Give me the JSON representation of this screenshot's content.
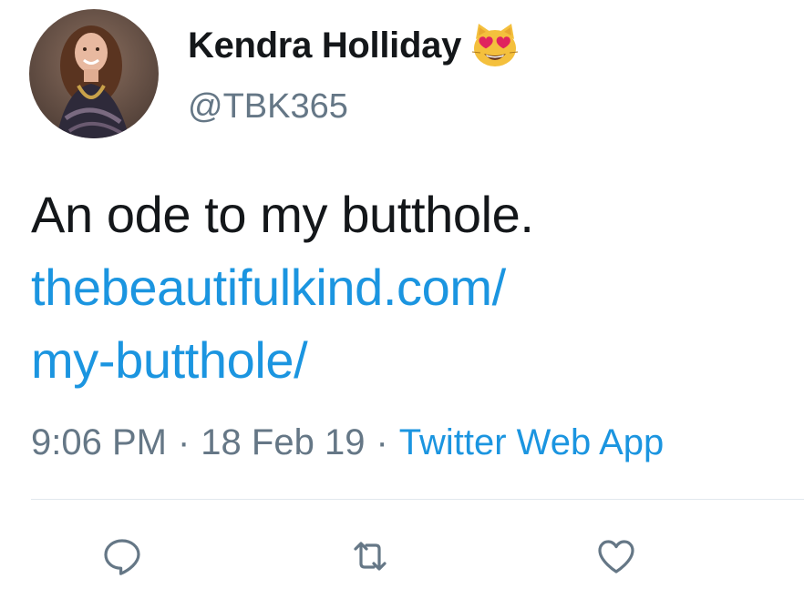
{
  "user": {
    "display_name": "Kendra Holliday",
    "name_emoji": "smiling-cat-heart-eyes-emoji",
    "handle": "@TBK365",
    "avatar": "profile-photo"
  },
  "tweet": {
    "text": "An ode to my butthole.",
    "link_line1": "thebeautifulkind.com/",
    "link_line2": "my-butthole/"
  },
  "meta": {
    "time": "9:06 PM",
    "separator": "·",
    "date": "18 Feb 19",
    "source": "Twitter Web App"
  },
  "actions": {
    "reply_icon": "reply-icon",
    "retweet_icon": "retweet-icon",
    "like_icon": "heart-icon"
  },
  "colors": {
    "text": "#14171a",
    "secondary": "#657786",
    "link": "#1b95e0",
    "divider": "#e1e8ed"
  }
}
